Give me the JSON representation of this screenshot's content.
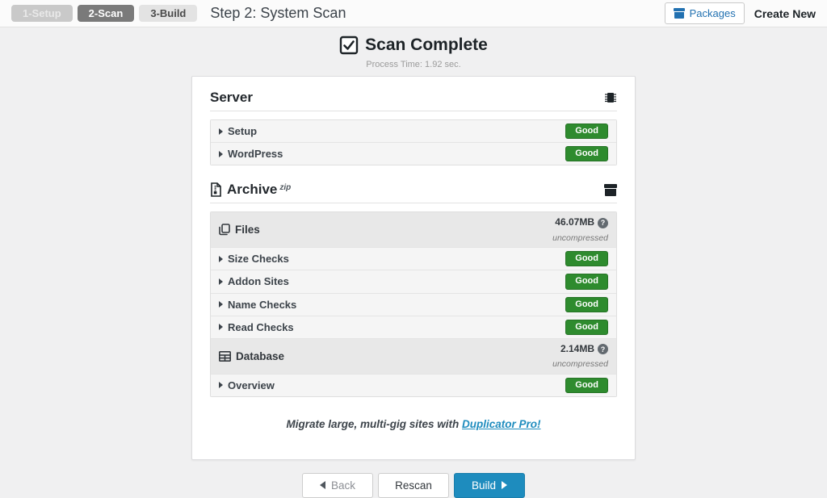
{
  "topbar": {
    "steps": [
      {
        "label": "1-Setup"
      },
      {
        "label": "2-Scan"
      },
      {
        "label": "3-Build"
      }
    ],
    "title": "Step 2: System Scan",
    "packages_label": "Packages",
    "create_new_label": "Create New"
  },
  "scan_header": {
    "title": "Scan Complete",
    "process_time": "Process Time: 1.92 sec."
  },
  "server_section": {
    "title": "Server",
    "rows": [
      {
        "label": "Setup",
        "status": "Good"
      },
      {
        "label": "WordPress",
        "status": "Good"
      }
    ]
  },
  "archive_section": {
    "title": "Archive",
    "format": "zip",
    "files_group": {
      "label": "Files",
      "size": "46.07MB",
      "note": "uncompressed"
    },
    "files_rows": [
      {
        "label": "Size Checks",
        "status": "Good"
      },
      {
        "label": "Addon Sites",
        "status": "Good"
      },
      {
        "label": "Name Checks",
        "status": "Good"
      },
      {
        "label": "Read Checks",
        "status": "Good"
      }
    ],
    "database_group": {
      "label": "Database",
      "size": "2.14MB",
      "note": "uncompressed"
    },
    "database_rows": [
      {
        "label": "Overview",
        "status": "Good"
      }
    ]
  },
  "promo": {
    "text": "Migrate large, multi-gig sites with",
    "link_label": "Duplicator Pro!"
  },
  "actions": {
    "back_label": "Back",
    "rescan_label": "Rescan",
    "build_label": "Build"
  },
  "icons": {
    "scan_complete": "checked-checkbox",
    "server": "microchip",
    "archive_title": "zip-file",
    "archive_right": "archive-box",
    "files": "copy-pages",
    "database": "table",
    "size_help": "question-circle",
    "packages": "archive-box"
  },
  "colors": {
    "good_badge": "#2e8b2e",
    "build_button": "#1e8cbe",
    "link": "#1e8cbe",
    "active_step": "#7a7a7a",
    "page_background": "#f0f0f1"
  }
}
